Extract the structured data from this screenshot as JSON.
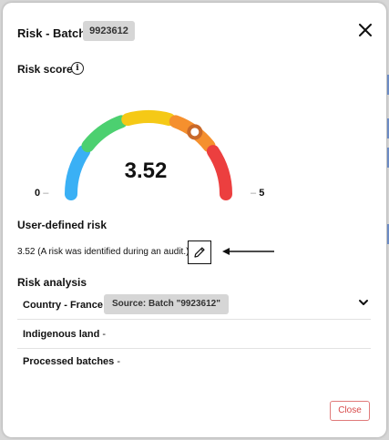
{
  "modal": {
    "title": "Risk - Batch",
    "batch_id": "9923612"
  },
  "risk_score": {
    "heading": "Risk score",
    "info_icon": "info-icon",
    "value": "3.52",
    "min_label": "0",
    "max_label": "5",
    "score_numeric": 3.52,
    "scale": [
      0,
      5
    ],
    "segment_colors": [
      "#3ab0f5",
      "#4cd070",
      "#f5c916",
      "#f5902e",
      "#ec3f3f"
    ]
  },
  "user_defined_risk": {
    "heading": "User-defined risk",
    "text": "3.52 (A risk was identified during an audit.)",
    "edit_icon": "pencil-icon"
  },
  "risk_analysis": {
    "heading": "Risk analysis",
    "rows": [
      {
        "label": "Country - France",
        "badge": "Source: Batch \"9923612\""
      },
      {
        "label": "Indigenous land",
        "suffix": " -"
      },
      {
        "label": "Processed batches",
        "suffix": " -"
      }
    ]
  },
  "footer": {
    "close_label": "Close"
  }
}
